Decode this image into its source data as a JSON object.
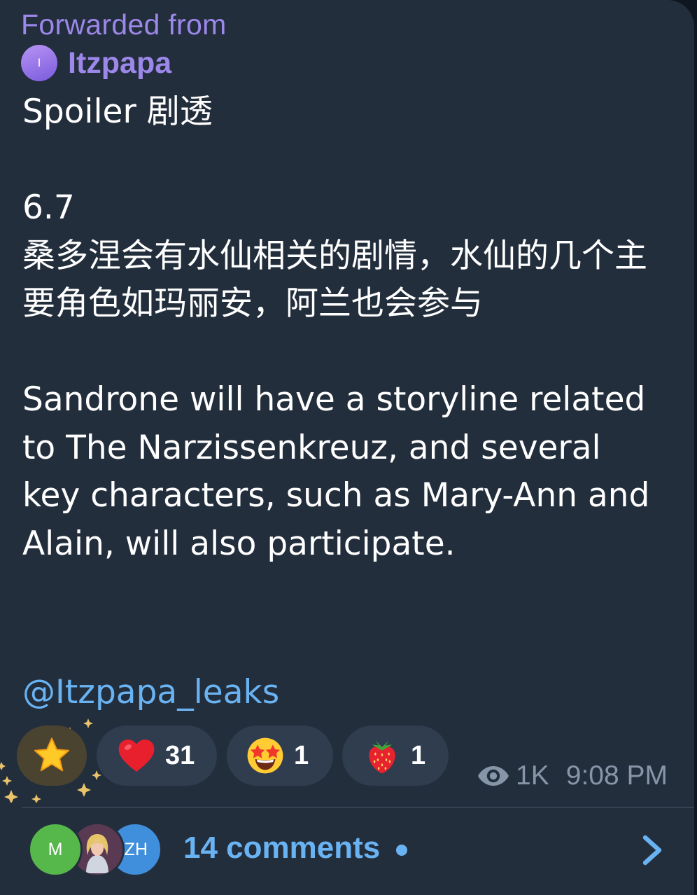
{
  "colors": {
    "bubble_bg": "#232e3c",
    "forward_accent": "#9c87ea",
    "link": "#6ab3f3",
    "meta": "#8696a8",
    "reaction_pill": "#2f3d4f"
  },
  "forward": {
    "label": "Forwarded from",
    "avatar_initial": "I",
    "source_name": "Itzpapa"
  },
  "message": {
    "text": "Spoiler 剧透\n\n6.7\n桑多涅会有水仙相关的剧情，水仙的几个主要角色如玛丽安，阿兰也会参与\n\nSandrone will have a storyline related to The Narzissenkreuz, and several key characters, such as Mary-Ann and Alain, will also participate.",
    "mention": "@Itzpapa_leaks"
  },
  "reactions": [
    {
      "icon": "star-emoji",
      "count": "",
      "selected": true
    },
    {
      "icon": "red-heart-emoji",
      "count": "31"
    },
    {
      "icon": "star-struck-emoji",
      "count": "1"
    },
    {
      "icon": "strawberry-emoji",
      "count": "1"
    }
  ],
  "meta": {
    "views": "1K",
    "time": "9:08 PM",
    "views_icon": "eye-icon"
  },
  "comments": {
    "avatars": [
      {
        "initials": "M",
        "color": "#56b74a"
      },
      {
        "initials": "",
        "kind": "photo"
      },
      {
        "initials": "ZH",
        "color": "#3f8fdc"
      }
    ],
    "label": "14 comments",
    "chevron_icon": "chevron-right-icon"
  }
}
